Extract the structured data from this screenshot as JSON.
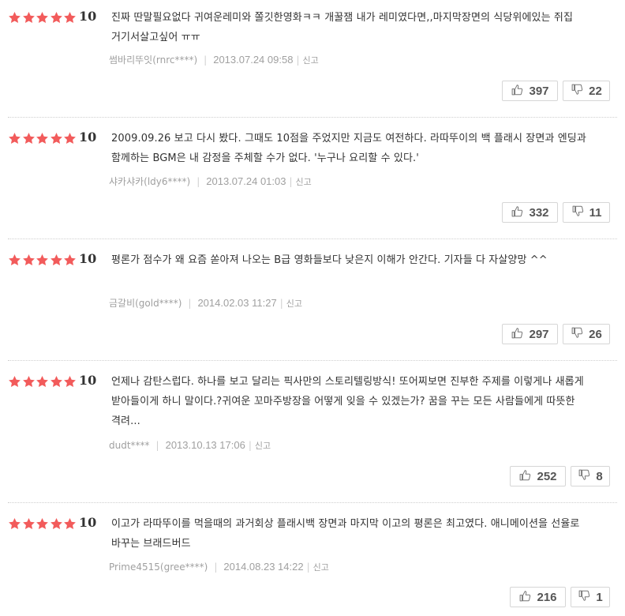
{
  "colors": {
    "star": "#f25b5b",
    "text": "#333333",
    "meta": "#a0a0a0",
    "border": "#d6d6d6"
  },
  "icons": {
    "star": "star-icon",
    "like": "thumbs-up-icon",
    "dislike": "thumbs-down-icon"
  },
  "reviews": [
    {
      "stars": 5,
      "score": "10",
      "text": "진짜 딴말필요없다 귀여운레미와 쫄깃한영화ㅋㅋ 개꿀잼 내가 레미였다면,,마지막장면의 식당위에있는 쥐집 거기서살고싶어 ㅠㅠ",
      "author": "썸바리뚜잇(rnrc****)",
      "date": "2013.07.24 09:58",
      "report": "신고",
      "likes": "397",
      "dislikes": "22"
    },
    {
      "stars": 5,
      "score": "10",
      "text": "2009.09.26 보고 다시 봤다. 그때도 10점을 주었지만 지금도 여전하다. 라따뚜이의 백 플래시 장면과 엔딩과 함께하는 BGM은 내 감정을 주체할 수가 없다. '누구나 요리할 수 있다.'",
      "author": "샤카샤카(ldy6****)",
      "date": "2013.07.24 01:03",
      "report": "신고",
      "likes": "332",
      "dislikes": "11"
    },
    {
      "stars": 5,
      "score": "10",
      "text": "평론가 점수가 왜 요즘 쏟아져 나오는 B급 영화들보다 낮은지 이해가 안간다. 기자들 다 자살양망 ^^",
      "author": "금갈비(gold****)",
      "date": "2014.02.03 11:27",
      "report": "신고",
      "likes": "297",
      "dislikes": "26"
    },
    {
      "stars": 5,
      "score": "10",
      "text": "언제나 감탄스럽다. 하나를 보고 달리는 픽사만의 스토리텔링방식! 또어찌보면 진부한 주제를 이렇게나 새롭게 받아들이게 하니 말이다.?귀여운 꼬마주방장을 어떻게 잊을 수 있겠는가? 꿈을 꾸는 모든 사람들에게 따뜻한 격려...",
      "author": "dudt****",
      "date": "2013.10.13 17:06",
      "report": "신고",
      "likes": "252",
      "dislikes": "8"
    },
    {
      "stars": 5,
      "score": "10",
      "text": "이고가 라따뚜이를 먹을때의 과거회상 플래시백 장면과 마지막 이고의 평론은 최고였다. 애니메이션을 선율로 바꾸는 브래드버드",
      "author": "Prime4515(gree****)",
      "date": "2014.08.23 14:22",
      "report": "신고",
      "likes": "216",
      "dislikes": "1"
    }
  ]
}
